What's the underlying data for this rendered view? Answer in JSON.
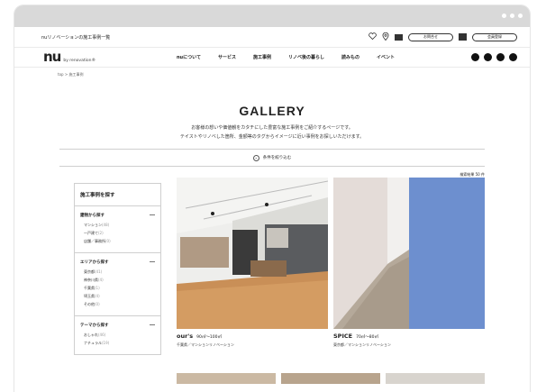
{
  "topbar": {
    "site_title": "nuリノベーションの施工事例一覧",
    "contact_label": "お問合せ",
    "register_label": "会員登録"
  },
  "nav": {
    "logo_mark": "nu",
    "logo_sub": "by renovation®",
    "menu": [
      "nuについて",
      "サービス",
      "施工事例",
      "リノベ後の暮らし",
      "読みもの",
      "イベント"
    ]
  },
  "breadcrumb": "top > 施工事例",
  "page_title": "GALLERY",
  "intro": {
    "line1": "お客様の想いや価値観をカタチにした豊富な施工事例をご紹介するページです。",
    "line2": "テイストやリノベした箇所、金額等のタグからイメージに近い事例をお探しいただけます。"
  },
  "filter_label": "条件を絞り込む",
  "result_count": "検索結果 50 件",
  "sidebar": {
    "heading": "施工事例を探す",
    "groups": [
      {
        "title": "建物から探す",
        "items": [
          [
            "マンション",
            "(48)"
          ],
          [
            "一戸建て",
            "(2)"
          ],
          [
            "店舗／事務所",
            "(0)"
          ]
        ]
      },
      {
        "title": "エリアから探す",
        "items": [
          [
            "東京都",
            "(41)"
          ],
          [
            "神奈川県",
            "(4)"
          ],
          [
            "千葉県",
            "(1)"
          ],
          [
            "埼玉県",
            "(4)"
          ],
          [
            "その他",
            "(0)"
          ]
        ]
      },
      {
        "title": "テーマから探す",
        "items": [
          [
            "おしゃれ",
            "(46)"
          ],
          [
            "ナチュラル",
            "(19)"
          ]
        ]
      }
    ]
  },
  "cards": [
    {
      "name": "our's",
      "size": "90㎡〜100㎡",
      "sub": "千葉県／マンションリノベーション"
    },
    {
      "name": "SPICE",
      "size": "70㎡〜80㎡",
      "sub": "東京都／マンションリノベーション"
    }
  ],
  "colors": {
    "ink": "#111111",
    "line": "#cfcfcf",
    "chrome": "#d9d9d9",
    "wall_blue": "#6d8fcf"
  }
}
